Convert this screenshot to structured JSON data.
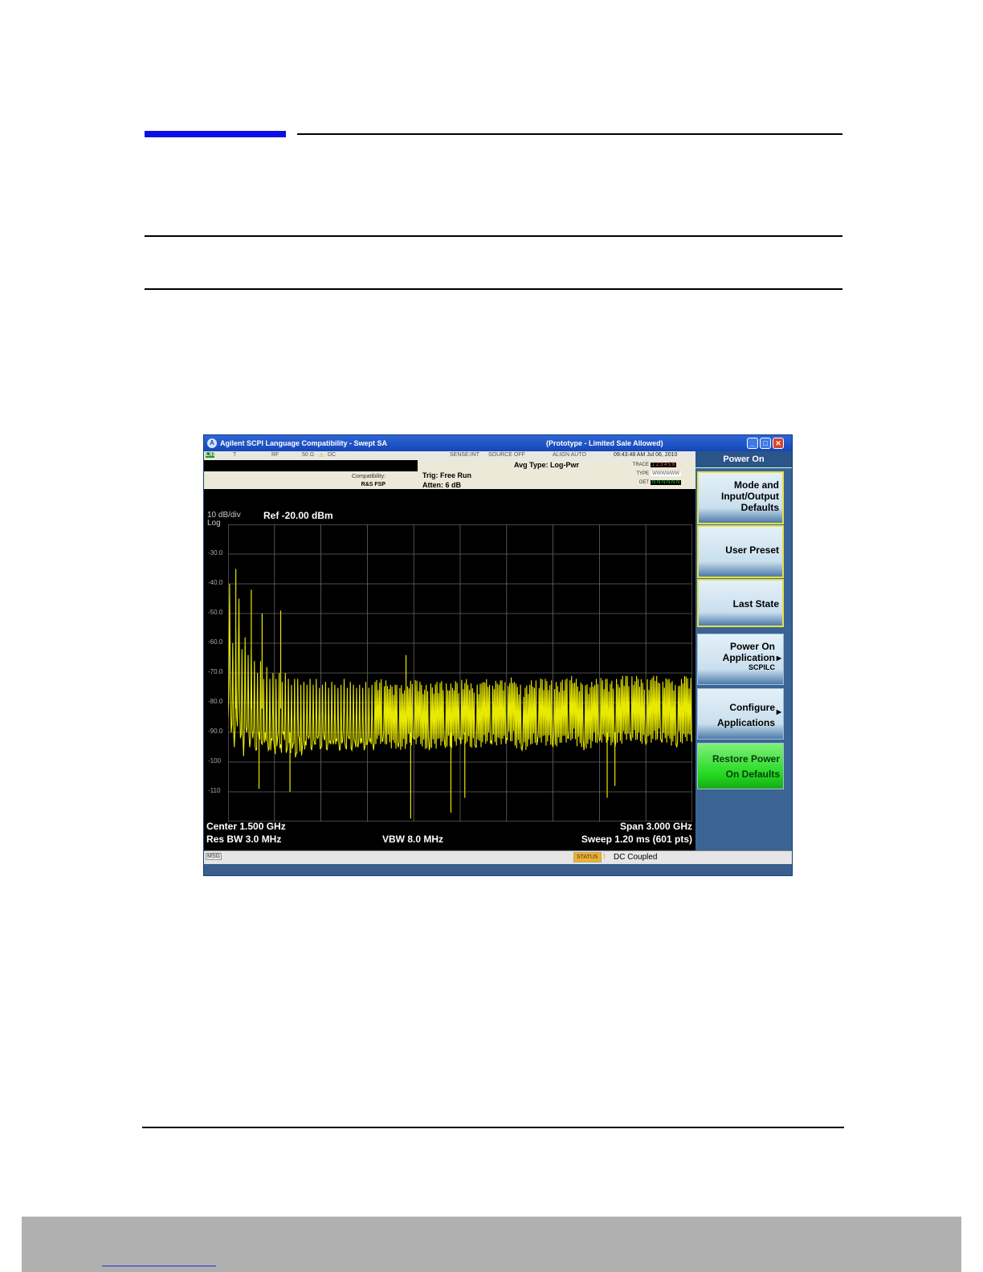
{
  "window": {
    "title": "Agilent SCPI Language Compatibility - Swept SA",
    "prototype_label": "(Prototype - Limited Sale Allowed)"
  },
  "status_row": {
    "lxi": "LXI",
    "t": "T",
    "rf": "RF",
    "impedance": "50 Ω",
    "warn": "⚠",
    "coupling": "DC",
    "sense": "SENSE:INT",
    "source": "SOURCE OFF",
    "align": "ALIGN AUTO",
    "datetime": "09:43:48 AM Jul 06, 2010"
  },
  "info": {
    "compat_label": "Compatibility:",
    "compat_value": "R&S FSP",
    "trig": "Trig: Free Run",
    "atten": "Atten: 6 dB",
    "avg_type": "Avg Type: Log-Pwr",
    "trace_label": "TRACE",
    "trace_value": "1 2 3 4 5 6",
    "type_label": "TYPE",
    "type_value": "WWWWWW",
    "det_label": "DET",
    "det_value": "N N N N N N"
  },
  "plot": {
    "scale": "10 dB/div",
    "scale_type": "Log",
    "ref": "Ref -20.00 dBm",
    "yticks": [
      "-30.0",
      "-40.0",
      "-50.0",
      "-60.0",
      "-70.0",
      "-80.0",
      "-90.0",
      "-100",
      "-110"
    ],
    "center": "Center 1.500 GHz",
    "res_bw": "Res BW 3.0 MHz",
    "vbw": "VBW 8.0 MHz",
    "span": "Span 3.000 GHz",
    "sweep": "Sweep  1.20 ms (601 pts)",
    "trace_color": "#e8e800"
  },
  "chart_data": {
    "type": "line",
    "title": "",
    "xlabel": "",
    "ylabel": "",
    "x_range_ghz": [
      0.0,
      3.0
    ],
    "ylim": [
      -120,
      -20
    ],
    "grid": true,
    "series": [
      {
        "name": "",
        "points": [
          [
            0.0,
            -85
          ],
          [
            0.01,
            -40
          ],
          [
            0.02,
            -90
          ],
          [
            0.03,
            -60
          ],
          [
            0.04,
            -95
          ],
          [
            0.05,
            -55
          ],
          [
            0.06,
            -88
          ],
          [
            0.07,
            -45
          ],
          [
            0.08,
            -92
          ],
          [
            0.09,
            -62
          ],
          [
            0.1,
            -98
          ],
          [
            0.11,
            -58
          ],
          [
            0.12,
            -90
          ],
          [
            0.13,
            -64
          ],
          [
            0.14,
            -95
          ],
          [
            0.15,
            -62
          ],
          [
            0.16,
            -92
          ],
          [
            0.17,
            -66
          ],
          [
            0.18,
            -96
          ],
          [
            0.19,
            -70
          ],
          [
            0.2,
            -92
          ],
          [
            0.21,
            -66
          ],
          [
            0.22,
            -94
          ],
          [
            0.23,
            -72
          ],
          [
            0.24,
            -90
          ],
          [
            0.25,
            -68
          ],
          [
            0.26,
            -96
          ],
          [
            0.27,
            -72
          ],
          [
            0.28,
            -92
          ],
          [
            0.29,
            -70
          ],
          [
            0.3,
            -95
          ],
          [
            0.31,
            -72
          ],
          [
            0.32,
            -92
          ],
          [
            0.33,
            -70
          ],
          [
            0.34,
            -94
          ],
          [
            0.35,
            -73
          ],
          [
            0.36,
            -90
          ],
          [
            0.37,
            -70
          ],
          [
            0.38,
            -96
          ],
          [
            0.39,
            -72
          ],
          [
            0.4,
            -92
          ],
          [
            0.41,
            -74
          ],
          [
            0.42,
            -94
          ],
          [
            0.43,
            -72
          ],
          [
            0.44,
            -97
          ],
          [
            0.45,
            -72
          ],
          [
            0.46,
            -92
          ],
          [
            0.47,
            -74
          ],
          [
            0.48,
            -95
          ],
          [
            0.49,
            -73
          ],
          [
            0.5,
            -93
          ],
          [
            0.51,
            -74
          ],
          [
            0.52,
            -92
          ],
          [
            0.53,
            -72
          ],
          [
            0.54,
            -96
          ],
          [
            0.55,
            -74
          ],
          [
            0.56,
            -94
          ],
          [
            0.57,
            -72
          ],
          [
            0.58,
            -92
          ],
          [
            0.59,
            -75
          ],
          [
            0.6,
            -95
          ],
          [
            0.61,
            -74
          ],
          [
            0.62,
            -92
          ],
          [
            0.63,
            -73
          ],
          [
            0.64,
            -96
          ],
          [
            0.65,
            -75
          ],
          [
            0.66,
            -93
          ],
          [
            0.67,
            -73
          ],
          [
            0.68,
            -94
          ],
          [
            0.69,
            -74
          ],
          [
            0.7,
            -92
          ],
          [
            0.71,
            -75
          ],
          [
            0.72,
            -96
          ],
          [
            0.73,
            -74
          ],
          [
            0.74,
            -93
          ],
          [
            0.75,
            -72
          ],
          [
            0.76,
            -95
          ],
          [
            0.77,
            -75
          ],
          [
            0.78,
            -92
          ],
          [
            0.79,
            -73
          ],
          [
            0.8,
            -96
          ],
          [
            0.81,
            -74
          ],
          [
            0.82,
            -93
          ],
          [
            0.83,
            -75
          ],
          [
            0.84,
            -95
          ],
          [
            0.85,
            -74
          ],
          [
            0.86,
            -92
          ],
          [
            0.87,
            -75
          ],
          [
            0.88,
            -96
          ],
          [
            0.89,
            -73
          ],
          [
            0.9,
            -94
          ],
          [
            0.91,
            -75
          ],
          [
            0.92,
            -92
          ],
          [
            0.93,
            -74
          ],
          [
            0.94,
            -96
          ],
          [
            0.95,
            -73
          ],
          [
            1.0,
            -93
          ],
          [
            1.05,
            -74
          ],
          [
            1.1,
            -95
          ],
          [
            1.15,
            -75
          ],
          [
            1.2,
            -92
          ],
          [
            1.25,
            -74
          ],
          [
            1.3,
            -96
          ],
          [
            1.35,
            -73
          ],
          [
            1.4,
            -94
          ],
          [
            1.45,
            -75
          ],
          [
            1.5,
            -92
          ],
          [
            1.55,
            -74
          ],
          [
            1.6,
            -95
          ],
          [
            1.65,
            -73
          ],
          [
            1.7,
            -93
          ],
          [
            1.75,
            -74
          ],
          [
            1.8,
            -92
          ],
          [
            1.85,
            -73
          ],
          [
            1.9,
            -96
          ],
          [
            1.95,
            -74
          ],
          [
            2.0,
            -93
          ],
          [
            2.05,
            -72
          ],
          [
            2.1,
            -95
          ],
          [
            2.15,
            -73
          ],
          [
            2.2,
            -92
          ],
          [
            2.25,
            -72
          ],
          [
            2.3,
            -96
          ],
          [
            2.35,
            -73
          ],
          [
            2.4,
            -93
          ],
          [
            2.45,
            -72
          ],
          [
            2.5,
            -95
          ],
          [
            2.55,
            -71
          ],
          [
            2.6,
            -92
          ],
          [
            2.65,
            -72
          ],
          [
            2.7,
            -94
          ],
          [
            2.75,
            -71
          ],
          [
            2.8,
            -93
          ],
          [
            2.85,
            -72
          ],
          [
            2.9,
            -95
          ],
          [
            2.95,
            -71
          ],
          [
            3.0,
            -93
          ]
        ]
      }
    ],
    "peaks_ghz_dbm": [
      [
        0.05,
        -35
      ],
      [
        0.15,
        -42
      ],
      [
        0.22,
        -50
      ],
      [
        0.34,
        -49
      ],
      [
        1.15,
        -64
      ],
      [
        1.18,
        -119
      ],
      [
        1.44,
        -117
      ],
      [
        1.53,
        -112
      ],
      [
        2.45,
        -112
      ],
      [
        2.5,
        -108
      ],
      [
        0.4,
        -110
      ],
      [
        0.2,
        -109
      ]
    ]
  },
  "softkeys": {
    "header": "Power On",
    "mode_defaults": [
      "Mode and",
      "Input/Output",
      "Defaults"
    ],
    "user_preset": "User Preset",
    "last_state": "Last State",
    "power_on_app": [
      "Power On",
      "Application"
    ],
    "power_on_app_sub": "SCPILC",
    "configure_apps": [
      "Configure",
      "Applications"
    ],
    "restore": [
      "Restore Power",
      "On Defaults"
    ]
  },
  "msgbar": {
    "msg": "MSG",
    "status": "STATUS",
    "warn": "!",
    "text": "DC Coupled"
  }
}
